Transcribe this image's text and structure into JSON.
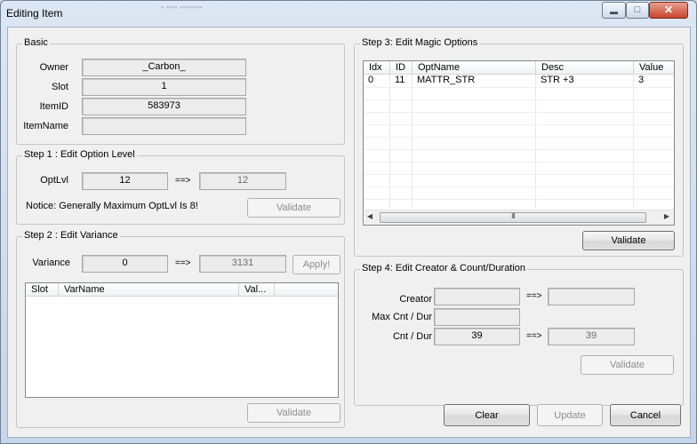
{
  "window": {
    "title": "Editing Item",
    "controls": {
      "minimize_icon": "minimize-icon",
      "maximize_icon": "maximize-icon",
      "close_icon": "close-icon"
    }
  },
  "basic": {
    "legend": "Basic",
    "fields": [
      {
        "label": "Owner",
        "value": "_Carbon_"
      },
      {
        "label": "Slot",
        "value": "1"
      },
      {
        "label": "ItemID",
        "value": "583973"
      },
      {
        "label": "ItemName",
        "value": ""
      }
    ]
  },
  "step1": {
    "legend": "Step 1 : Edit Option Level",
    "label": "OptLvl",
    "current": "12",
    "arrow": "==>",
    "new_value": "12",
    "notice": "Notice: Generally Maximum OptLvl Is 8!",
    "validate_label": "Validate"
  },
  "step2": {
    "legend": "Step 2 : Edit Variance",
    "label": "Variance",
    "current": "0",
    "arrow": "==>",
    "new_value": "3131",
    "apply_label": "Apply!",
    "columns": [
      "Slot",
      "VarName",
      "Val..."
    ],
    "validate_label": "Validate"
  },
  "step3": {
    "legend": "Step 3: Edit Magic Options",
    "columns": [
      "Idx",
      "ID",
      "OptName",
      "Desc",
      "Value"
    ],
    "rows": [
      {
        "idx": "0",
        "id": "11",
        "optname": "MATTR_STR",
        "desc": "STR +3",
        "value": "3"
      }
    ],
    "scroll_grip": "III",
    "validate_label": "Validate"
  },
  "step4": {
    "legend": "Step 4: Edit Creator & Count/Duration",
    "creator_label": "Creator",
    "creator_value": "",
    "creator_new": "",
    "maxcnt_label": "Max Cnt / Dur",
    "maxcnt_value": "",
    "cnt_label": "Cnt / Dur",
    "cnt_value": "39",
    "cnt_new": "39",
    "arrow": "==>",
    "validate_label": "Validate"
  },
  "footer": {
    "clear_label": "Clear",
    "update_label": "Update",
    "cancel_label": "Cancel"
  }
}
